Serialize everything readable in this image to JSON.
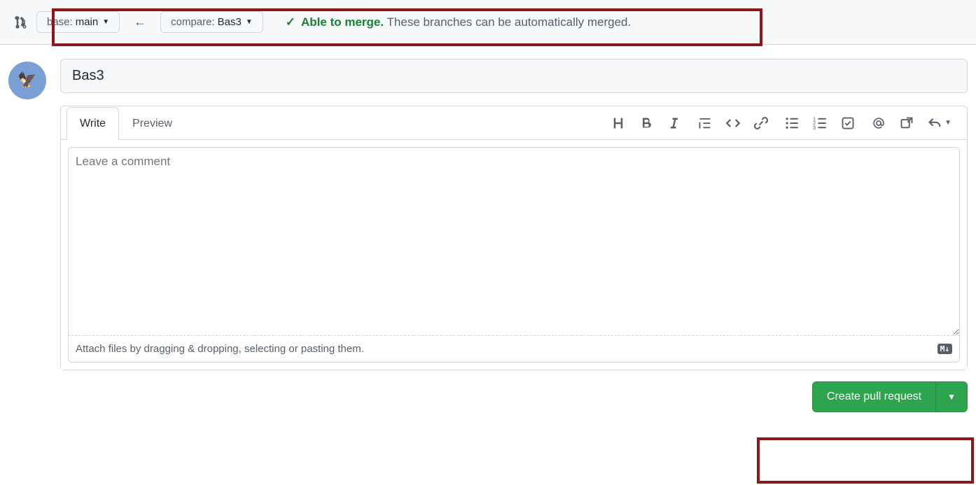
{
  "compare": {
    "base_label_prefix": "base:",
    "base_branch": "main",
    "compare_label_prefix": "compare:",
    "compare_branch": "Bas3",
    "merge_status_bold": "Able to merge.",
    "merge_status_rest": "These branches can be automatically merged."
  },
  "form": {
    "title_value": "Bas3",
    "tabs": {
      "write": "Write",
      "preview": "Preview"
    },
    "comment_placeholder": "Leave a comment",
    "attach_hint": "Attach files by dragging & dropping, selecting or pasting them.",
    "markdown_badge": "M↓"
  },
  "actions": {
    "create_pr": "Create pull request"
  }
}
